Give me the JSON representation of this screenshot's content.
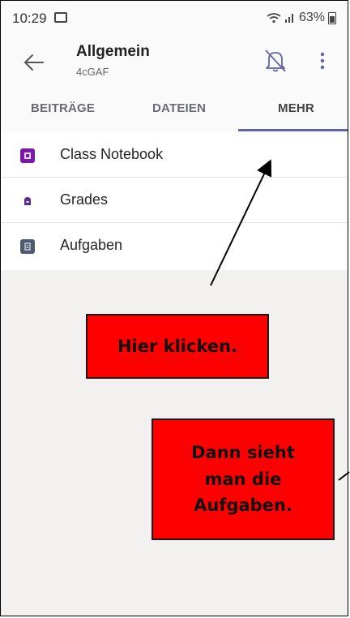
{
  "status_bar": {
    "time": "10:29",
    "battery": "63%"
  },
  "header": {
    "title": "Allgemein",
    "subtitle": "4cGAF"
  },
  "tabs": [
    {
      "label": "BEITRÄGE"
    },
    {
      "label": "DATEIEN"
    },
    {
      "label": "MEHR"
    }
  ],
  "list": [
    {
      "label": "Class Notebook",
      "icon": "onenote-icon",
      "color": "#7719aa"
    },
    {
      "label": "Grades",
      "icon": "grades-icon",
      "color": "#5c2d91"
    },
    {
      "label": "Aufgaben",
      "icon": "assignments-icon",
      "color": "#4e5a6e"
    }
  ],
  "annotations": {
    "callout1": "Hier klicken.",
    "callout2_line1": "Dann sieht",
    "callout2_line2": "man die",
    "callout2_line3": "Aufgaben."
  },
  "colors": {
    "accent": "#6264a7",
    "callout": "#ff0000"
  }
}
